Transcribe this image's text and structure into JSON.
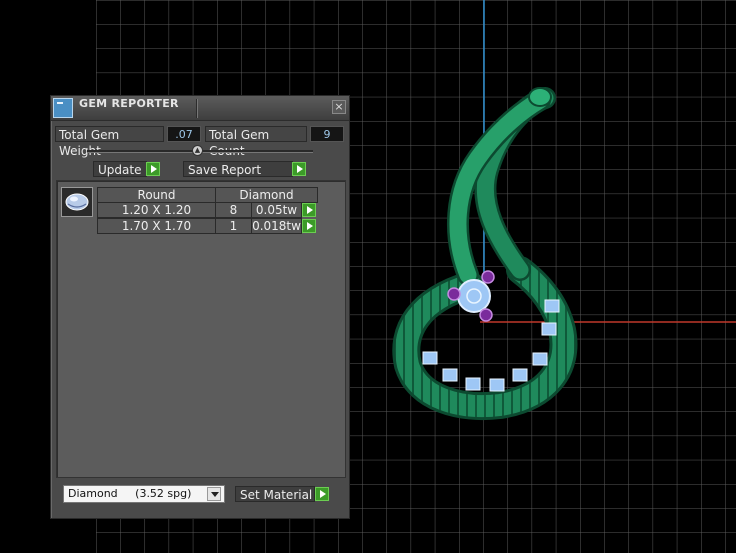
{
  "panel": {
    "title": "GEM REPORTER",
    "close_glyph": "×",
    "total_weight_label": "Total Gem Weight",
    "total_weight_value": ".07",
    "total_count_label": "Total Gem Count",
    "total_count_value": "9",
    "update_label": "Update",
    "save_report_label": "Save Report",
    "table": {
      "headers": [
        "Round",
        "Diamond"
      ],
      "rows": [
        {
          "size": "1.20 X 1.20",
          "count": "8",
          "weight": "0.05tw"
        },
        {
          "size": "1.70 X 1.70",
          "count": "1",
          "weight": "0.018tw"
        }
      ]
    },
    "material_select": "Diamond     (3.52 spg)",
    "set_material_label": "Set Material"
  },
  "colors": {
    "accent_green": "#3c9b28",
    "metal_green": "#1f8a5c",
    "gem_blue": "#9ec7f5",
    "prong_purple": "#7a2b9c",
    "axis_red": "#c0392b",
    "axis_blue": "#2f8fd0"
  },
  "icons": {
    "app": "gem-reporter-icon",
    "close": "close-icon",
    "play": "play-arrow-icon",
    "dropdown": "chevron-down-icon",
    "gem": "gem-thumbnail-icon"
  }
}
